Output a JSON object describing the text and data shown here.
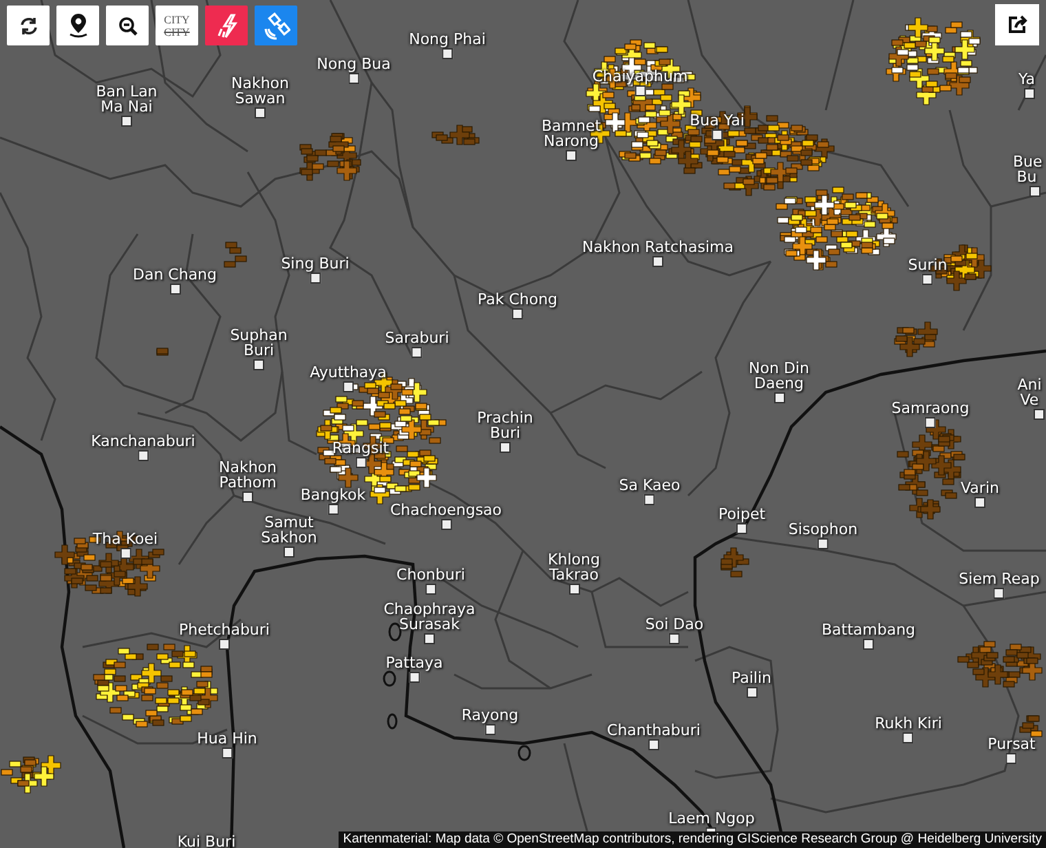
{
  "toolbar": {
    "buttons": [
      {
        "kind": "refresh"
      },
      {
        "kind": "locate"
      },
      {
        "kind": "zoom-out"
      },
      {
        "kind": "city",
        "label": "CITY",
        "struck_label": "CITY",
        "on": false
      },
      {
        "kind": "lightning",
        "on": true
      },
      {
        "kind": "satellite",
        "on": true
      }
    ]
  },
  "map": {
    "cities": [
      {
        "name": "Nong Phai"
      },
      {
        "name": "Nong Bua"
      },
      {
        "name": "Nakhon Sawan"
      },
      {
        "name": "Ban Lan Ma Nai"
      },
      {
        "name": "Chaiyaphum"
      },
      {
        "name": "Ya"
      },
      {
        "name": "Bamnet Narong"
      },
      {
        "name": "Bua Yai"
      },
      {
        "name": "Bue Bu"
      },
      {
        "name": "Nakhon Ratchasima"
      },
      {
        "name": "Surin"
      },
      {
        "name": "Sing Buri"
      },
      {
        "name": "Dan Chang"
      },
      {
        "name": "Pak Chong"
      },
      {
        "name": "Suphan Buri"
      },
      {
        "name": "Saraburi"
      },
      {
        "name": "Ayutthaya"
      },
      {
        "name": "Non Din Daeng"
      },
      {
        "name": "Ani Ve"
      },
      {
        "name": "Samraong"
      },
      {
        "name": "Prachin Buri"
      },
      {
        "name": "Kanchanaburi"
      },
      {
        "name": "Rangsit"
      },
      {
        "name": "Nakhon Pathom"
      },
      {
        "name": "Bangkok"
      },
      {
        "name": "Sa Kaeo"
      },
      {
        "name": "Varin"
      },
      {
        "name": "Chachoengsao"
      },
      {
        "name": "Samut Sakhon"
      },
      {
        "name": "Poipet"
      },
      {
        "name": "Sisophon"
      },
      {
        "name": "Tha Koei"
      },
      {
        "name": "Chonburi"
      },
      {
        "name": "Khlong Takrao"
      },
      {
        "name": "Siem Reap"
      },
      {
        "name": "Phetchaburi"
      },
      {
        "name": "Chaophraya Surasak"
      },
      {
        "name": "Soi Dao"
      },
      {
        "name": "Battambang"
      },
      {
        "name": "Pattaya"
      },
      {
        "name": "Pailin"
      },
      {
        "name": "Rayong"
      },
      {
        "name": "Rukh Kiri"
      },
      {
        "name": "Chanthaburi"
      },
      {
        "name": "Hua Hin"
      },
      {
        "name": "Pursat"
      },
      {
        "name": "Laem Ngop"
      },
      {
        "name": "Kui Buri"
      }
    ],
    "attribution": "Kartenmaterial: Map data © OpenStreetMap contributors, rendering GIScience Research Group @ Heidelberg University"
  }
}
